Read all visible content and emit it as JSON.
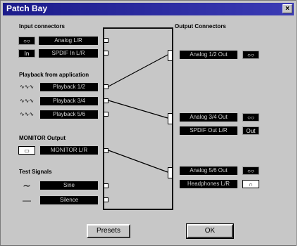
{
  "window": {
    "title": "Patch Bay",
    "close_glyph": "×"
  },
  "sections": {
    "input": "Input connectors",
    "playback": "Playback from application",
    "monitor": "MONITOR Output",
    "test": "Test Signals",
    "output": "Output Connectors"
  },
  "inputs": [
    {
      "icon": "audio-jack-icon",
      "icon_text": "○○",
      "label": "Analog L/R"
    },
    {
      "icon": "spdif-icon",
      "icon_text": "In",
      "label": "SPDIF In L/R"
    }
  ],
  "playback": [
    {
      "icon": "waveform-icon",
      "icon_text": "∿∿∿",
      "label": "Playback 1/2"
    },
    {
      "icon": "waveform-icon",
      "icon_text": "∿∿∿",
      "label": "Playback 3/4"
    },
    {
      "icon": "waveform-icon",
      "icon_text": "∿∿∿",
      "label": "Playback 5/6"
    }
  ],
  "monitor": {
    "icon": "monitor-icon",
    "icon_text": "▭",
    "label": "MONITOR L/R"
  },
  "test_signals": [
    {
      "icon": "sine-icon",
      "icon_text": "∼",
      "label": "Sine"
    },
    {
      "icon": "silence-icon",
      "icon_text": "—",
      "label": "Silence"
    }
  ],
  "outputs": [
    {
      "label": "Analog 1/2 Out",
      "icon": "audio-jack-icon",
      "icon_text": "○○"
    },
    {
      "label": "Analog 3/4 Out",
      "icon": "audio-jack-icon",
      "icon_text": "○○"
    },
    {
      "label": "SPDIF Out L/R",
      "icon": "spdif-out-icon",
      "icon_text": "Out"
    },
    {
      "label": "Analog 5/6 Out",
      "icon": "audio-jack-icon",
      "icon_text": "○○"
    },
    {
      "label": "Headphones L/R",
      "icon": "headphones-icon",
      "icon_text": "∩"
    }
  ],
  "buttons": {
    "presets": "Presets",
    "ok": "OK"
  }
}
